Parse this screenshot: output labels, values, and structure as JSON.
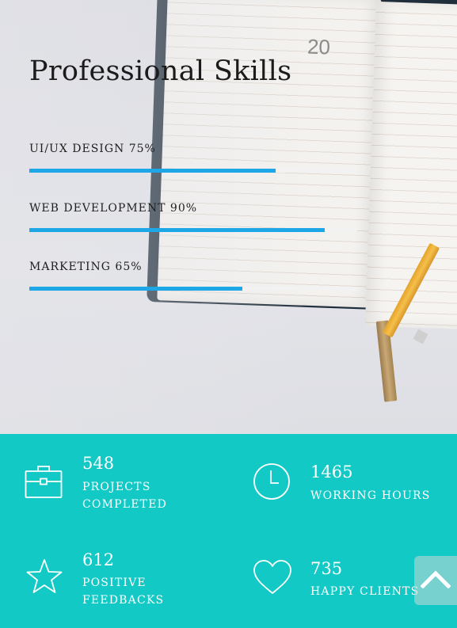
{
  "skills": {
    "title": "Professional Skills",
    "items": [
      {
        "label": "UI/UX DESIGN 75%",
        "percent": 75
      },
      {
        "label": "WEB DEVELOPMENT 90%",
        "percent": 90
      },
      {
        "label": "MARKETING 65%",
        "percent": 65
      }
    ]
  },
  "planner": {
    "date": "20"
  },
  "stats": [
    {
      "value": "548",
      "label_line1": "PROJECTS",
      "label_line2": "COMPLETED",
      "icon": "briefcase-icon"
    },
    {
      "value": "1465",
      "label_line1": "WORKING HOURS",
      "label_line2": "",
      "icon": "clock-icon"
    },
    {
      "value": "612",
      "label_line1": "POSITIVE",
      "label_line2": "FEEDBACKS",
      "icon": "star-icon"
    },
    {
      "value": "735",
      "label_line1": "HAPPY CLIENTS",
      "label_line2": "",
      "icon": "heart-icon"
    }
  ],
  "colors": {
    "accent": "#1ea7e6",
    "stats_background": "#13c9c6",
    "bar_track": "#f2f2f2"
  },
  "back_to_top": {
    "icon": "chevron-up-icon"
  }
}
